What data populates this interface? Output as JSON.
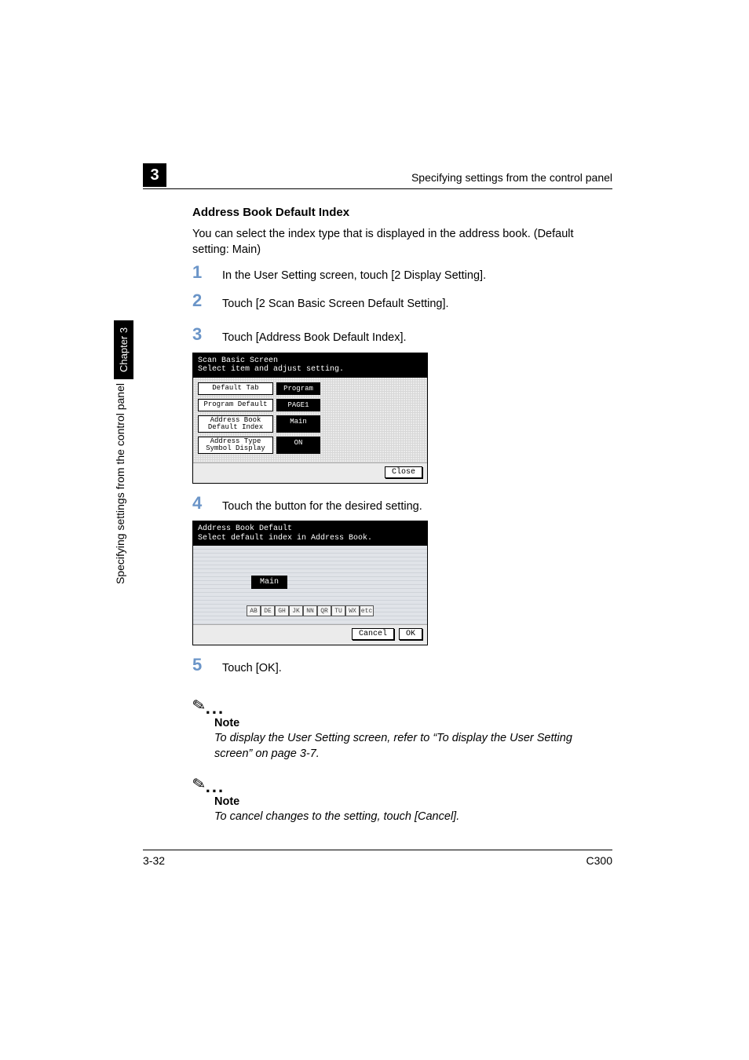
{
  "header": {
    "running": "Specifying settings from the control panel",
    "chapter_num": "3"
  },
  "sidebar": {
    "tab": "Chapter 3",
    "text": "Specifying settings from the control panel"
  },
  "section": {
    "heading": "Address Book Default Index",
    "intro": "You can select the index type that is displayed in the address book. (Default setting: Main)"
  },
  "steps": {
    "s1": {
      "num": "1",
      "text": "In the User Setting screen, touch [2 Display Setting]."
    },
    "s2": {
      "num": "2",
      "text": "Touch [2 Scan Basic Screen Default Setting]."
    },
    "s3": {
      "num": "3",
      "text": "Touch [Address Book Default Index]."
    },
    "s4": {
      "num": "4",
      "text": "Touch the button for the desired setting."
    },
    "s5": {
      "num": "5",
      "text": "Touch [OK]."
    }
  },
  "panel1": {
    "title": "Scan Basic Screen\nSelect item and adjust setting.",
    "rows": [
      {
        "label": "Default Tab",
        "value": "Program"
      },
      {
        "label": "Program Default",
        "value": "PAGE1"
      },
      {
        "label": "Address Book\nDefault Index",
        "value": "Main"
      },
      {
        "label": "Address Type\nSymbol Display",
        "value": "ON"
      }
    ],
    "close": "Close"
  },
  "panel2": {
    "title": "Address Book Default\nSelect default index in Address Book.",
    "main": "Main",
    "index_tabs": [
      "AB",
      "DE",
      "GH",
      "JK",
      "NN",
      "QR",
      "TU",
      "WX",
      "etc"
    ],
    "cancel": "Cancel",
    "ok": "OK"
  },
  "notes": {
    "label": "Note",
    "n1": "To display the User Setting screen, refer to “To display the User Setting screen” on page 3-7.",
    "n2": "To cancel changes to the setting, touch [Cancel]."
  },
  "footer": {
    "page": "3-32",
    "model": "C300"
  },
  "chart_data": null
}
